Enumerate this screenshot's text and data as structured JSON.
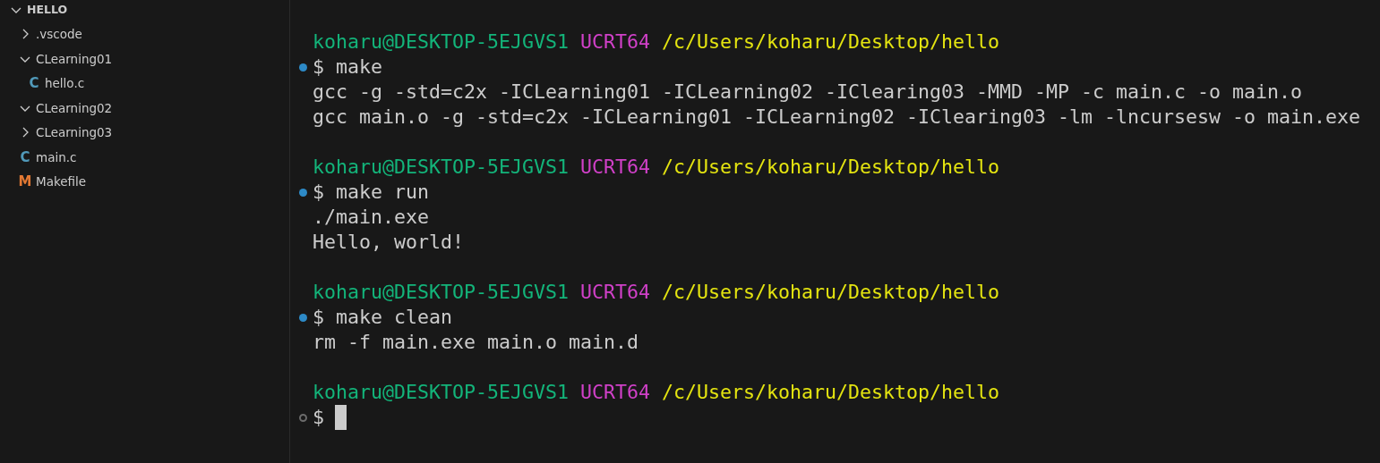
{
  "explorer": {
    "root": {
      "label": "HELLO",
      "expanded": true
    },
    "items": [
      {
        "kind": "folder",
        "label": ".vscode",
        "expanded": false
      },
      {
        "kind": "folder",
        "label": "CLearning01",
        "expanded": true,
        "children": [
          {
            "kind": "file",
            "label": "hello.c",
            "icon": "C",
            "color": "#519aba"
          }
        ]
      },
      {
        "kind": "folder",
        "label": "CLearning02",
        "expanded": true
      },
      {
        "kind": "folder",
        "label": "CLearning03",
        "expanded": false
      },
      {
        "kind": "file",
        "label": "main.c",
        "icon": "C",
        "color": "#519aba"
      },
      {
        "kind": "file",
        "label": "Makefile",
        "icon": "M",
        "color": "#e37933"
      }
    ]
  },
  "terminal": {
    "blocks": [
      {
        "user": "koharu@DESKTOP-5EJGVS1",
        "env": "UCRT64",
        "path": "/c/Users/koharu/Desktop/hello",
        "symbol": "$",
        "command": "make",
        "done": true,
        "cursor": false,
        "output": [
          "gcc -g -std=c2x -ICLearning01 -ICLearning02 -IClearing03 -MMD -MP -c main.c -o main.o",
          "gcc main.o -g -std=c2x -ICLearning01 -ICLearning02 -IClearing03 -lm -lncursesw -o main.exe"
        ]
      },
      {
        "user": "koharu@DESKTOP-5EJGVS1",
        "env": "UCRT64",
        "path": "/c/Users/koharu/Desktop/hello",
        "symbol": "$",
        "command": "make run",
        "done": true,
        "cursor": false,
        "output": [
          "./main.exe",
          "Hello, world!"
        ]
      },
      {
        "user": "koharu@DESKTOP-5EJGVS1",
        "env": "UCRT64",
        "path": "/c/Users/koharu/Desktop/hello",
        "symbol": "$",
        "command": "make clean",
        "done": true,
        "cursor": false,
        "output": [
          "rm -f main.exe main.o main.d"
        ]
      },
      {
        "user": "koharu@DESKTOP-5EJGVS1",
        "env": "UCRT64",
        "path": "/c/Users/koharu/Desktop/hello",
        "symbol": "$",
        "done": false,
        "cursor": true
      }
    ]
  }
}
